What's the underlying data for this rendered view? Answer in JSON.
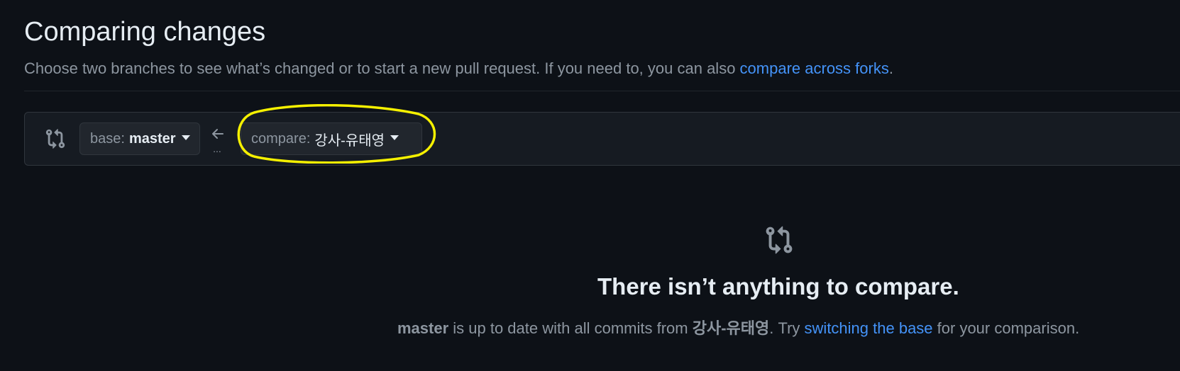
{
  "header": {
    "title": "Comparing changes",
    "subtitle_text": "Choose two branches to see what’s changed or to start a new pull request. If you need to, you can also ",
    "subtitle_link": "compare across forks",
    "subtitle_end": "."
  },
  "range": {
    "icon": "git-compare-icon",
    "base_prefix": "base:",
    "base_branch": "master",
    "arrow_icon": "arrow-left-icon",
    "ellipsis": "...",
    "compare_prefix": "compare:",
    "compare_branch": "강사-유태영"
  },
  "empty_state": {
    "icon": "git-compare-icon",
    "title": "There isn’t anything to compare.",
    "desc_base": "master",
    "desc_mid": " is up to date with all commits from ",
    "desc_compare": "강사-유태영",
    "desc_try": ". Try ",
    "desc_link": "switching the base",
    "desc_end": " for your comparison."
  },
  "colors": {
    "background": "#0d1117",
    "link": "#4493f8",
    "highlight": "#f5f000"
  }
}
